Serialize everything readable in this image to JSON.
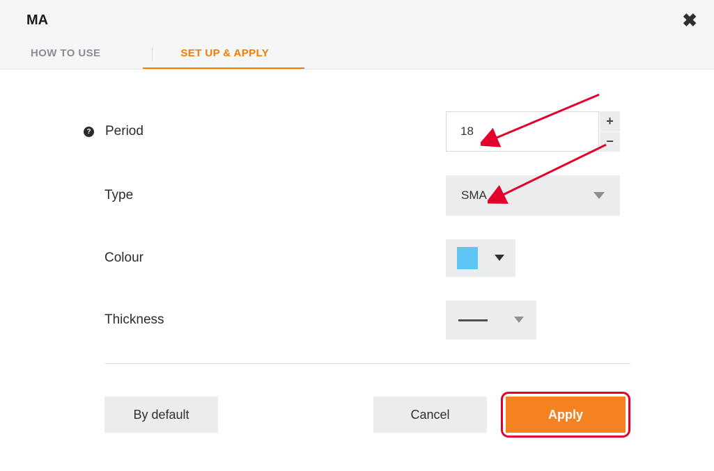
{
  "header": {
    "title": "MA",
    "tabs": {
      "how_to_use": "HOW TO USE",
      "setup_apply": "SET UP & APPLY"
    }
  },
  "fields": {
    "period": {
      "label": "Period",
      "value": "18"
    },
    "type": {
      "label": "Type",
      "value": "SMA"
    },
    "colour": {
      "label": "Colour",
      "value_hex": "#5ec5f5"
    },
    "thickness": {
      "label": "Thickness"
    }
  },
  "buttons": {
    "default": "By default",
    "cancel": "Cancel",
    "apply": "Apply"
  },
  "colors": {
    "accent": "#f57c00",
    "primary_btn": "#f58220",
    "highlight": "#e4002b"
  }
}
